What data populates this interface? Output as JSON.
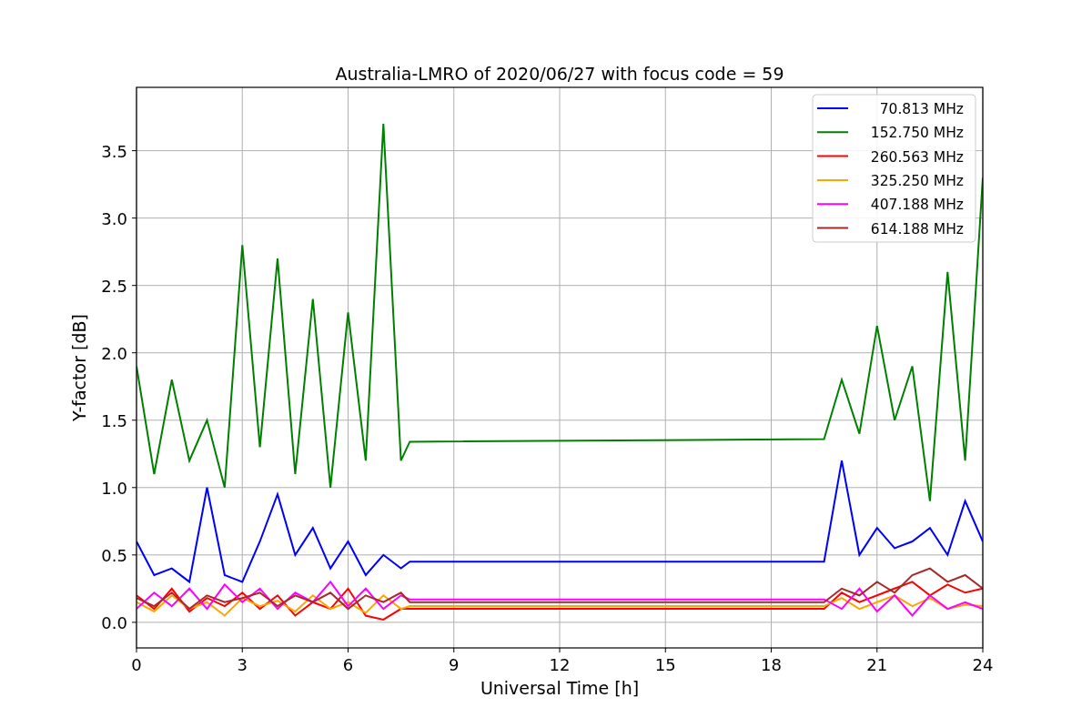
{
  "chart_data": {
    "type": "line",
    "title": "Australia-LMRO of 2020/06/27 with focus code = 59",
    "xlabel": "Universal Time [h]",
    "ylabel": "Y-factor [dB]",
    "x": [
      0,
      0.5,
      1,
      1.5,
      2,
      2.5,
      3,
      3.5,
      4,
      4.5,
      5,
      5.5,
      6,
      6.5,
      7,
      7.5,
      7.75,
      19.5,
      20,
      20.5,
      21,
      21.5,
      22,
      22.5,
      23,
      23.5,
      24
    ],
    "series": [
      {
        "name": "70.813 MHz",
        "color": "#0000ff",
        "values": [
          0.6,
          0.35,
          0.4,
          0.3,
          1.0,
          0.35,
          0.3,
          0.6,
          0.95,
          0.5,
          0.7,
          0.4,
          0.6,
          0.35,
          0.5,
          0.4,
          0.45,
          0.45,
          1.2,
          0.5,
          0.7,
          0.55,
          0.6,
          0.7,
          0.5,
          0.9,
          0.6
        ]
      },
      {
        "name": "152.750 MHz",
        "color": "#008000",
        "values": [
          1.9,
          1.1,
          1.8,
          1.2,
          1.5,
          1.0,
          2.8,
          1.3,
          2.7,
          1.1,
          2.4,
          1.0,
          2.3,
          1.2,
          3.7,
          1.2,
          1.34,
          1.36,
          1.8,
          1.4,
          2.2,
          1.5,
          1.9,
          0.9,
          2.6,
          1.2,
          3.3
        ]
      },
      {
        "name": "260.563 MHz",
        "color": "#ff0000",
        "values": [
          0.2,
          0.1,
          0.25,
          0.08,
          0.18,
          0.12,
          0.22,
          0.1,
          0.2,
          0.05,
          0.15,
          0.1,
          0.25,
          0.05,
          0.02,
          0.1,
          0.1,
          0.1,
          0.22,
          0.15,
          0.2,
          0.25,
          0.3,
          0.2,
          0.28,
          0.22,
          0.25
        ]
      },
      {
        "name": "325.250 MHz",
        "color": "#ffa500",
        "values": [
          0.15,
          0.08,
          0.2,
          0.1,
          0.15,
          0.05,
          0.18,
          0.12,
          0.16,
          0.08,
          0.2,
          0.1,
          0.15,
          0.07,
          0.2,
          0.1,
          0.12,
          0.12,
          0.18,
          0.1,
          0.15,
          0.2,
          0.12,
          0.18,
          0.1,
          0.13,
          0.12
        ]
      },
      {
        "name": "407.188 MHz",
        "color": "#ff00ff",
        "values": [
          0.1,
          0.22,
          0.12,
          0.25,
          0.1,
          0.28,
          0.15,
          0.25,
          0.1,
          0.22,
          0.15,
          0.3,
          0.12,
          0.25,
          0.1,
          0.2,
          0.17,
          0.17,
          0.1,
          0.25,
          0.08,
          0.2,
          0.05,
          0.2,
          0.1,
          0.15,
          0.1
        ]
      },
      {
        "name": "614.188 MHz",
        "color": "#a52a2a",
        "values": [
          0.18,
          0.12,
          0.22,
          0.1,
          0.2,
          0.15,
          0.18,
          0.22,
          0.12,
          0.2,
          0.15,
          0.22,
          0.1,
          0.2,
          0.15,
          0.22,
          0.15,
          0.15,
          0.25,
          0.2,
          0.3,
          0.22,
          0.35,
          0.4,
          0.3,
          0.35,
          0.25
        ]
      }
    ],
    "xlim": [
      0,
      24
    ],
    "ylim": [
      -0.19,
      3.97
    ],
    "xticks": [
      0,
      3,
      6,
      9,
      12,
      15,
      18,
      21,
      24
    ],
    "yticks": [
      {
        "value": 0,
        "label": "0.0"
      },
      0.5,
      {
        "value": 1,
        "label": "1.0"
      },
      1.5,
      {
        "value": 2,
        "label": "2.0"
      },
      2.5,
      {
        "value": 3,
        "label": "3.0"
      },
      3.5
    ],
    "grid": true,
    "legend": true
  }
}
